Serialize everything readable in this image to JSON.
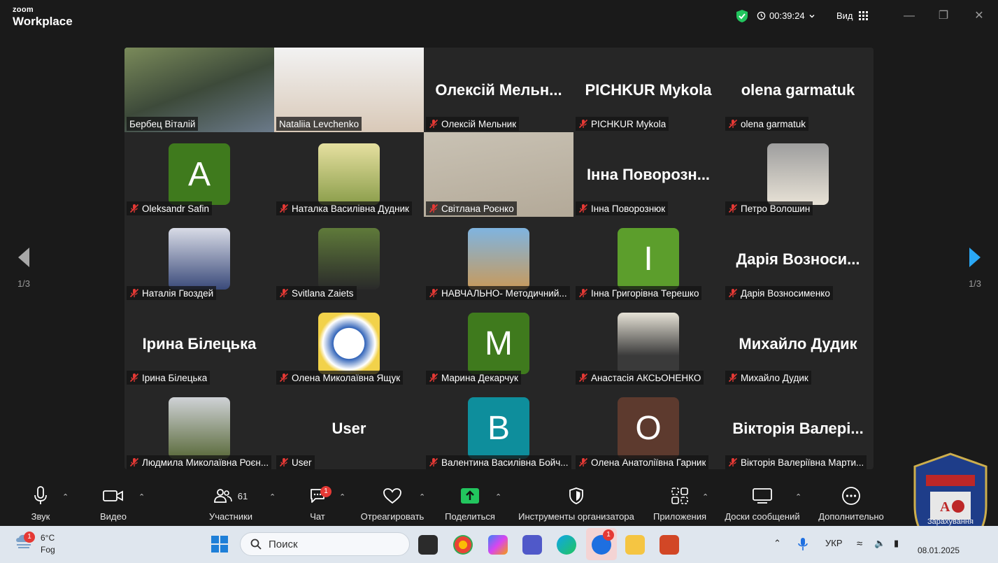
{
  "app": {
    "brand_top": "zoom",
    "brand_bottom": "Workplace"
  },
  "header": {
    "timer": "00:39:24",
    "view_label": "Вид"
  },
  "pager": {
    "left": "1/3",
    "right": "1/3"
  },
  "participants": [
    {
      "name": "Бербец Віталій",
      "kind": "video",
      "muted": false,
      "active": true
    },
    {
      "name": "Nataliia Levchenko",
      "kind": "video",
      "muted": false
    },
    {
      "name": "Олексій Мельник",
      "kind": "text",
      "big": "Олексій Мельн...",
      "muted": true
    },
    {
      "name": "PICHKUR Mykola",
      "kind": "text",
      "big": "PICHKUR Mykola",
      "muted": true
    },
    {
      "name": "olena garmatuk",
      "kind": "text",
      "big": "olena garmatuk",
      "muted": true
    },
    {
      "name": "Oleksandr Safin",
      "kind": "letter",
      "letter": "A",
      "color": "#3f7a1d",
      "muted": true
    },
    {
      "name": "Наталка Василівна Дудник",
      "kind": "avatar",
      "muted": true
    },
    {
      "name": "Світлана Роєнко",
      "kind": "video",
      "muted": true
    },
    {
      "name": "Інна Поворознюк",
      "kind": "text",
      "big": "Інна Поворозн...",
      "muted": true
    },
    {
      "name": "Петро Волошин",
      "kind": "avatar",
      "muted": true
    },
    {
      "name": "Наталія Гвоздей",
      "kind": "avatar",
      "muted": true
    },
    {
      "name": "Svitlana Zaiets",
      "kind": "avatar",
      "muted": true
    },
    {
      "name": "НАВЧАЛЬНО- Методичний...",
      "kind": "avatar",
      "muted": true
    },
    {
      "name": "Інна Григорівна Терешко",
      "kind": "letter",
      "letter": "I",
      "color": "#5c9e2c",
      "muted": true
    },
    {
      "name": "Дарія Возносименко",
      "kind": "text",
      "big": "Дарія Возноси...",
      "muted": true
    },
    {
      "name": "Ірина Білецька",
      "kind": "text",
      "big": "Ірина Білецька",
      "muted": true
    },
    {
      "name": "Олена Миколаївна Ящук",
      "kind": "avatar",
      "muted": true
    },
    {
      "name": "Марина Декарчук",
      "kind": "letter",
      "letter": "M",
      "color": "#3f7a1d",
      "muted": true
    },
    {
      "name": "Анастасія АКСЬОНЕНКО",
      "kind": "avatar",
      "muted": true
    },
    {
      "name": "Михайло Дудик",
      "kind": "text",
      "big": "Михайло Дудик",
      "muted": true
    },
    {
      "name": "Людмила Миколаївна Роєн...",
      "kind": "avatar",
      "muted": true
    },
    {
      "name": "User",
      "kind": "text",
      "big": "User",
      "muted": true
    },
    {
      "name": "Валентина Василівна Бойч...",
      "kind": "letter",
      "letter": "B",
      "color": "#0e8e9c",
      "muted": true
    },
    {
      "name": "Олена Анатоліївна Гарник",
      "kind": "letter",
      "letter": "O",
      "color": "#5d3a2e",
      "muted": true
    },
    {
      "name": "Вікторія Валеріївна Марти...",
      "kind": "text",
      "big": "Вікторія Валері...",
      "muted": true
    }
  ],
  "toolbar": {
    "audio": "Звук",
    "video": "Видео",
    "participants": "Участники",
    "participants_count": "61",
    "chat": "Чат",
    "chat_badge": "1",
    "react": "Отреагировать",
    "share": "Поделиться",
    "host_tools": "Инструменты организатора",
    "apps": "Приложения",
    "whiteboards": "Доски сообщений",
    "more": "Дополнительно"
  },
  "taskbar": {
    "weather_temp": "6°C",
    "weather_desc": "Fog",
    "weather_badge": "1",
    "search_placeholder": "Поиск",
    "zoom_badge": "1",
    "lang": "УКР",
    "date": "08.01.2025"
  },
  "overlay": {
    "recording_text": "Зарахування"
  },
  "colors": {
    "active_border": "#4fd17b",
    "share_green": "#22c55e",
    "muted_red": "#e53935",
    "badge_red": "#e53935"
  }
}
